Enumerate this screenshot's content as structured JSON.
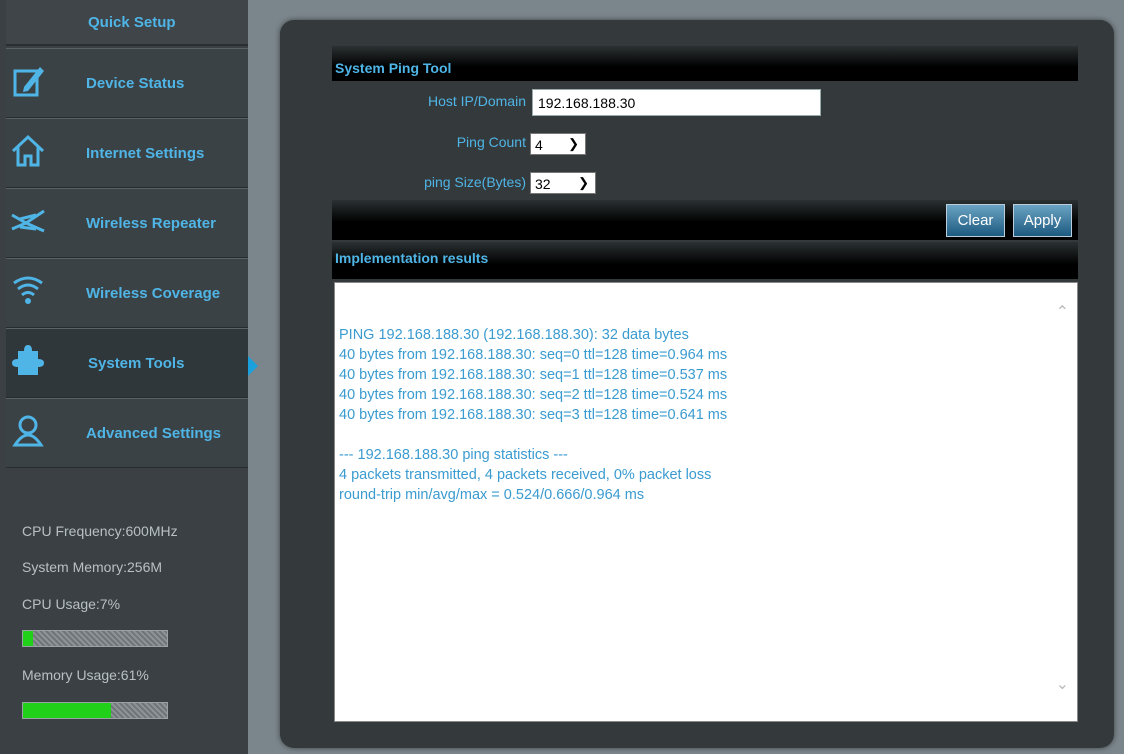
{
  "sidebar": {
    "quick_setup": "Quick Setup",
    "items": [
      {
        "label": "Device Status",
        "icon": "edit-icon"
      },
      {
        "label": "Internet Settings",
        "icon": "home-icon"
      },
      {
        "label": "Wireless Repeater",
        "icon": "repeater-icon"
      },
      {
        "label": "Wireless Coverage",
        "icon": "wifi-icon"
      },
      {
        "label": "System Tools",
        "icon": "puzzle-icon"
      },
      {
        "label": "Advanced Settings",
        "icon": "user-icon"
      }
    ],
    "cpu_frequency": "CPU Frequency:600MHz",
    "system_memory": "System Memory:256M",
    "cpu_usage": "CPU Usage:7%",
    "cpu_usage_value": 0.07,
    "memory_usage": "Memory Usage:61%",
    "memory_usage_value": 0.61
  },
  "ping_tool": {
    "title": "System Ping Tool",
    "host_label": "Host IP/Domain",
    "host_value": "192.168.188.30",
    "count_label": "Ping Count",
    "count_value": "4",
    "size_label": "ping Size(Bytes)",
    "size_value": "32",
    "clear_label": "Clear",
    "apply_label": "Apply",
    "results_title": "Implementation results",
    "results_text": "PING 192.168.188.30 (192.168.188.30): 32 data bytes\n40 bytes from 192.168.188.30: seq=0 ttl=128 time=0.964 ms\n40 bytes from 192.168.188.30: seq=1 ttl=128 time=0.537 ms\n40 bytes from 192.168.188.30: seq=2 ttl=128 time=0.524 ms\n40 bytes from 192.168.188.30: seq=3 ttl=128 time=0.641 ms\n\n--- 192.168.188.30 ping statistics ---\n4 packets transmitted, 4 packets received, 0% packet loss\nround-trip min/avg/max = 0.524/0.666/0.964 ms"
  },
  "colors": {
    "accent": "#4fb5e6",
    "usage_fill": "#21d018",
    "panel": "#34393c"
  }
}
